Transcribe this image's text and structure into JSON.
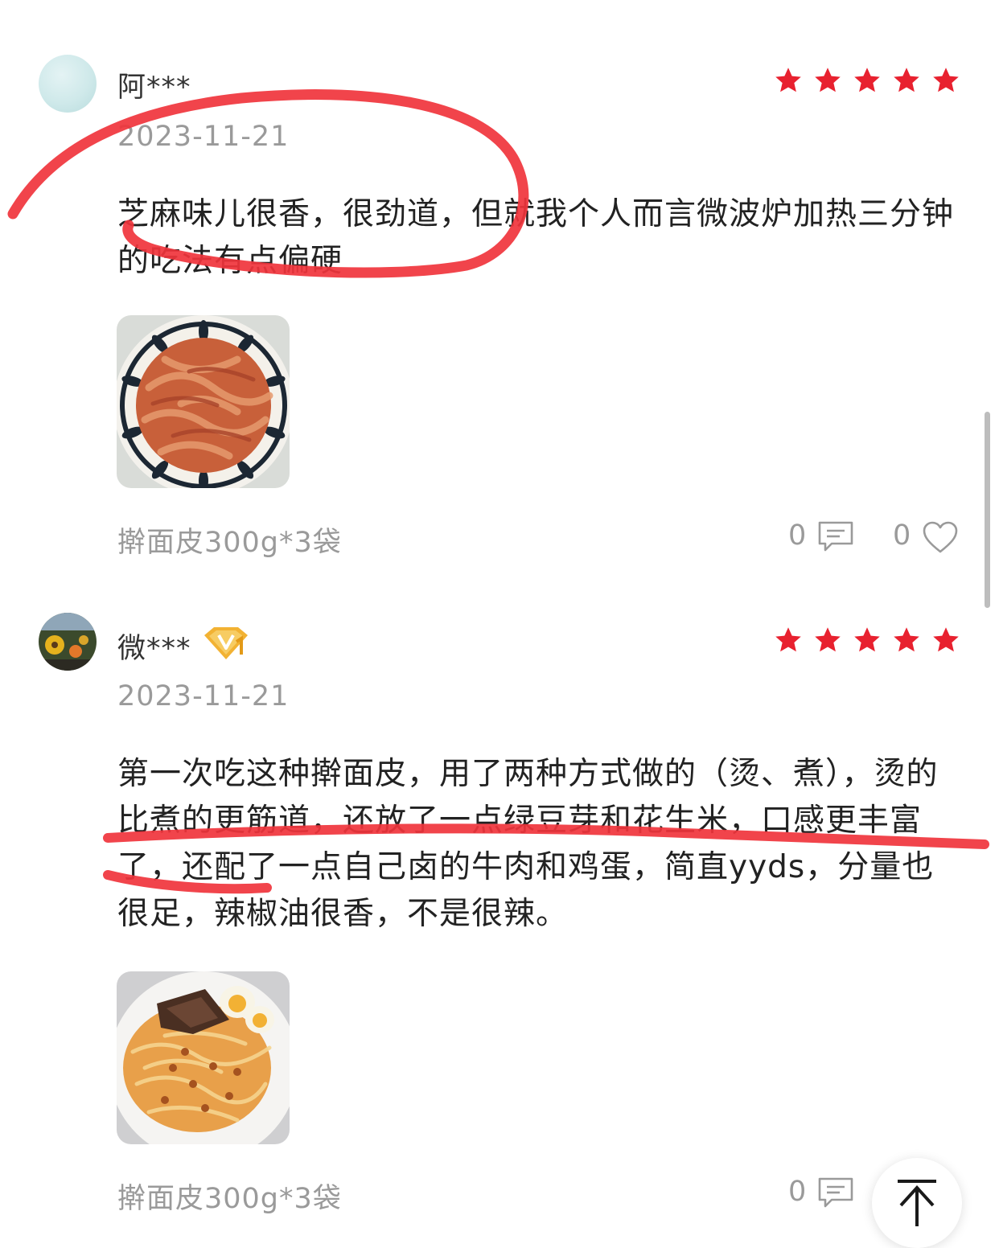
{
  "colors": {
    "star": "#e8212f",
    "annotation": "#f0343c",
    "muted_text": "#9a9a9a",
    "vip_gold": "#f2b233"
  },
  "reviews": [
    {
      "username": "阿***",
      "rating": 5,
      "date": "2023-11-21",
      "text": "芝麻味儿很香，很劲道，但就我个人而言微波炉加热三分钟的吃法有点偏硬",
      "spec": "擀面皮300g*3袋",
      "comment_count": "0",
      "like_count": "0"
    },
    {
      "username": "微***",
      "rating": 5,
      "vip_level": "1",
      "date": "2023-11-21",
      "text": "第一次吃这种擀面皮，用了两种方式做的（烫、煮），烫的比煮的更筋道，还放了一点绿豆芽和花生米，口感更丰富了，还配了一点自己卤的牛肉和鸡蛋，简直yyds，分量也很足，辣椒油很香，不是很辣。",
      "spec": "擀面皮300g*3袋",
      "comment_count": "0"
    }
  ],
  "icons": {
    "comment": "comment-icon",
    "like": "heart-icon",
    "back_to_top": "arrow-up-icon",
    "rating": "star-icon",
    "vip": "vip-badge-icon"
  }
}
